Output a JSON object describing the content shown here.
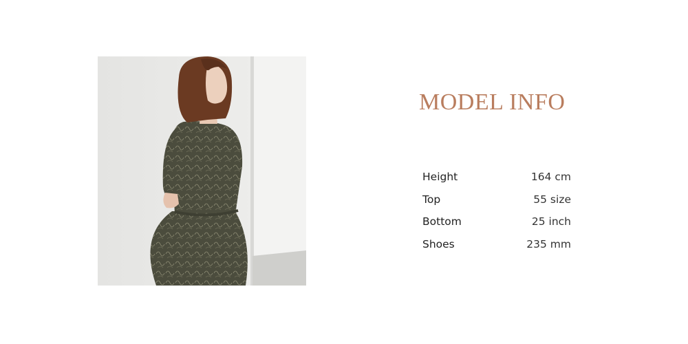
{
  "model_info": {
    "title": "MODEL INFO",
    "specs": [
      {
        "label": "Height",
        "value": "164 cm"
      },
      {
        "label": "Top",
        "value": "55 size"
      },
      {
        "label": "Bottom",
        "value": "25 inch"
      },
      {
        "label": "Shoes",
        "value": "235 mm"
      }
    ]
  },
  "colors": {
    "title_accent": "#b97d5e",
    "dress": "#4a4b3c",
    "hair": "#6b3a22",
    "wall": "#e9e9e7"
  }
}
